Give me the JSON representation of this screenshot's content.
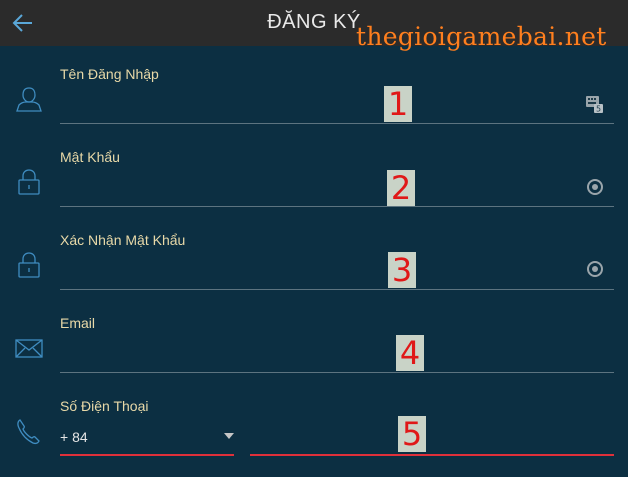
{
  "header": {
    "title": "ĐĂNG KÝ",
    "back_icon": "arrow-left-icon"
  },
  "watermark": "thegioigamebai.net",
  "fields": [
    {
      "label": "Tên Đăng Nhập",
      "badge": "1",
      "icon": "user-icon",
      "right_icon": "keyboard-badge-icon"
    },
    {
      "label": "Mật Khẩu",
      "badge": "2",
      "icon": "lock-icon",
      "right_icon": "eye-icon"
    },
    {
      "label": "Xác Nhận Mật Khẩu",
      "badge": "3",
      "icon": "lock-icon",
      "right_icon": "eye-icon"
    },
    {
      "label": "Email",
      "badge": "4",
      "icon": "mail-icon"
    },
    {
      "label": "Số Điện Thoại",
      "badge": "5",
      "icon": "phone-icon"
    }
  ],
  "phone": {
    "country_code": "+ 84"
  },
  "colors": {
    "background": "#0c2f42",
    "header": "#2b2b2b",
    "label": "#e8d9a8",
    "watermark": "#ff7f1e",
    "accent_red": "#e0303a"
  }
}
